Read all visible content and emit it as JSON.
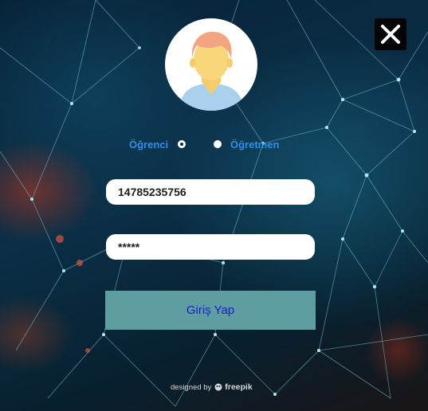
{
  "window": {
    "close_icon": "close-icon",
    "close_colors": {
      "background": "#050507",
      "glyph": "#ffffff"
    }
  },
  "avatar": {
    "icon": "user-avatar-icon"
  },
  "roles": {
    "student_label": "Öğrenci",
    "teacher_label": "Öğretmen",
    "selected": "student",
    "label_color": "#2f8fe8"
  },
  "login": {
    "username_value": "14785235756",
    "password_value": "*****",
    "submit_label": "Giriş Yap",
    "button_color": "#5f9ea0",
    "button_text_color": "#1a1ad6"
  },
  "footer": {
    "credit_prefix": "designed by",
    "credit_brand": "freepik",
    "credit_icon": "freepik-logo-icon"
  }
}
